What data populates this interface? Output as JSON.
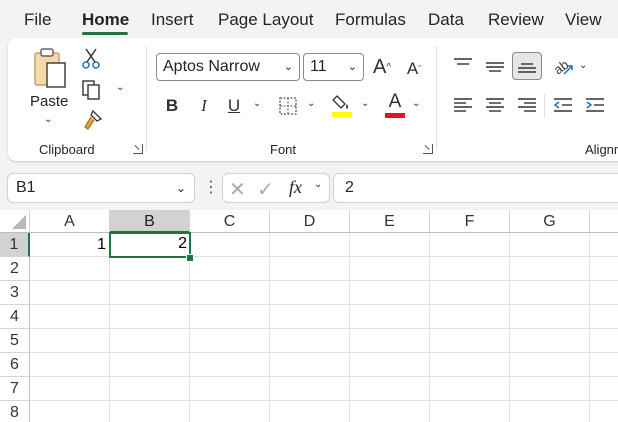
{
  "menu": {
    "tabs": [
      "File",
      "Home",
      "Insert",
      "Page Layout",
      "Formulas",
      "Data",
      "Review",
      "View"
    ],
    "active": "Home"
  },
  "ribbon": {
    "clipboard": {
      "paste_label": "Paste",
      "group_label": "Clipboard"
    },
    "font": {
      "font_name": "Aptos Narrow",
      "font_size": "11",
      "group_label": "Font",
      "bold": "B",
      "italic": "I",
      "underline": "U",
      "grow": "A",
      "shrink": "A",
      "font_color_letter": "A",
      "highlight_color": "#ffff00",
      "font_color": "#e81123"
    },
    "alignment": {
      "group_label": "Alignment"
    }
  },
  "formula_bar": {
    "name_box": "B1",
    "fx": "fx",
    "content": "2"
  },
  "sheet": {
    "columns": [
      "A",
      "B",
      "C",
      "D",
      "E",
      "F",
      "G"
    ],
    "rows": [
      "1",
      "2",
      "3",
      "4",
      "5",
      "6",
      "7",
      "8"
    ],
    "selected_column": "B",
    "selected_row": "1",
    "cells": {
      "A1": "1",
      "B1": "2"
    },
    "accent": "#217346"
  }
}
